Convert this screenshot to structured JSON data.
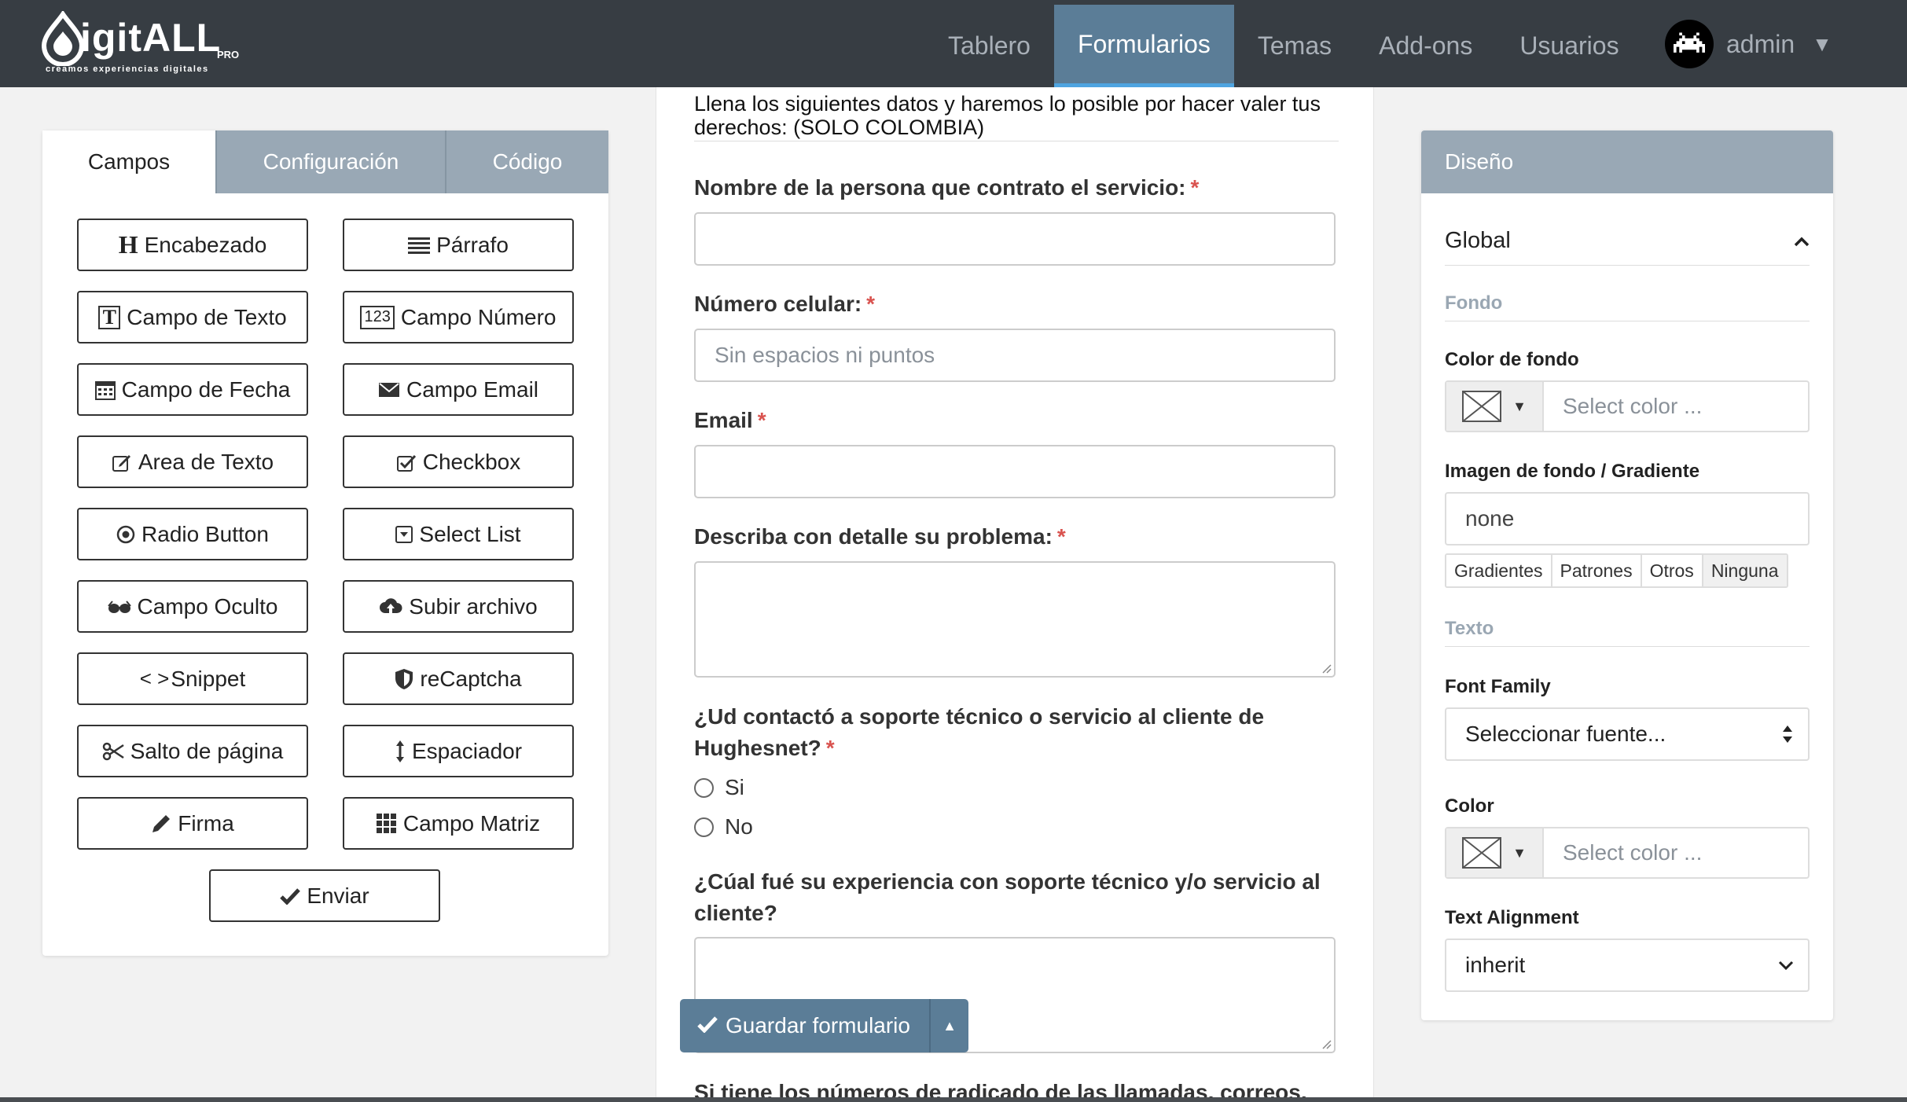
{
  "navbar": {
    "logo_text": "igitALL",
    "logo_pro": "PRO",
    "logo_tagline": "creamos experiencias digitales",
    "items": [
      {
        "label": "Tablero",
        "active": false
      },
      {
        "label": "Formularios",
        "active": true
      },
      {
        "label": "Temas",
        "active": false
      },
      {
        "label": "Add-ons",
        "active": false
      },
      {
        "label": "Usuarios",
        "active": false
      }
    ],
    "user_name": "admin"
  },
  "left_panel": {
    "tabs": [
      {
        "label": "Campos",
        "active": true
      },
      {
        "label": "Configuración",
        "active": false
      },
      {
        "label": "Código",
        "active": false
      }
    ],
    "fields": [
      {
        "label": "Encabezado",
        "icon": "heading-icon"
      },
      {
        "label": "Párrafo",
        "icon": "paragraph-icon"
      },
      {
        "label": "Campo de Texto",
        "icon": "text-field-icon"
      },
      {
        "label": "Campo Número",
        "icon": "number-field-icon"
      },
      {
        "label": "Campo de Fecha",
        "icon": "calendar-icon"
      },
      {
        "label": "Campo Email",
        "icon": "envelope-icon"
      },
      {
        "label": "Area de Texto",
        "icon": "edit-icon"
      },
      {
        "label": "Checkbox",
        "icon": "checkbox-icon"
      },
      {
        "label": "Radio Button",
        "icon": "radio-icon"
      },
      {
        "label": "Select List",
        "icon": "select-icon"
      },
      {
        "label": "Campo Oculto",
        "icon": "glasses-icon"
      },
      {
        "label": "Subir archivo",
        "icon": "cloud-upload-icon"
      },
      {
        "label": "Snippet",
        "icon": "code-icon"
      },
      {
        "label": "reCaptcha",
        "icon": "shield-icon"
      },
      {
        "label": "Salto de página",
        "icon": "scissors-icon"
      },
      {
        "label": "Espaciador",
        "icon": "vertical-arrows-icon"
      },
      {
        "label": "Firma",
        "icon": "pencil-icon"
      },
      {
        "label": "Campo Matriz",
        "icon": "grid-icon"
      }
    ],
    "submit_label": "Enviar",
    "number_icon_text": "123",
    "snippet_icon_text": "< >"
  },
  "form": {
    "intro": "Llena los siguientes datos y haremos lo posible por hacer valer tus derechos: (SOLO COLOMBIA)",
    "required_mark": "*",
    "fields": {
      "name_label": "Nombre de la persona que contrato el servicio:",
      "phone_label": "Número celular:",
      "phone_placeholder": "Sin espacios ni puntos",
      "email_label": "Email",
      "problem_label": "Describa con detalle su problema:",
      "contact_label": "¿Ud contactó a soporte técnico o servicio al cliente de Hughesnet?",
      "contact_options": [
        "Si",
        "No"
      ],
      "experience_label": "¿Cúal fué su experiencia con soporte técnico y/o servicio al cliente?",
      "radicado_label": "Si tiene los números de radicado de las llamadas, correos,"
    },
    "save_label": "Guardar formulario"
  },
  "right_panel": {
    "header": "Diseño",
    "global_label": "Global",
    "section_fondo": "Fondo",
    "bg_color_label": "Color de fondo",
    "color_placeholder": "Select color ...",
    "bg_image_label": "Imagen de fondo / Gradiente",
    "bg_image_value": "none",
    "bg_options": [
      "Gradientes",
      "Patrones",
      "Otros",
      "Ninguna"
    ],
    "section_texto": "Texto",
    "font_family_label": "Font Family",
    "font_family_value": "Seleccionar fuente...",
    "color_label": "Color",
    "text_align_label": "Text Alignment",
    "text_align_value": "inherit"
  },
  "colors": {
    "navbar_bg": "#373d43",
    "active_nav": "#5b7d97",
    "panel_header": "#99a8b5",
    "required": "#d9534f"
  }
}
